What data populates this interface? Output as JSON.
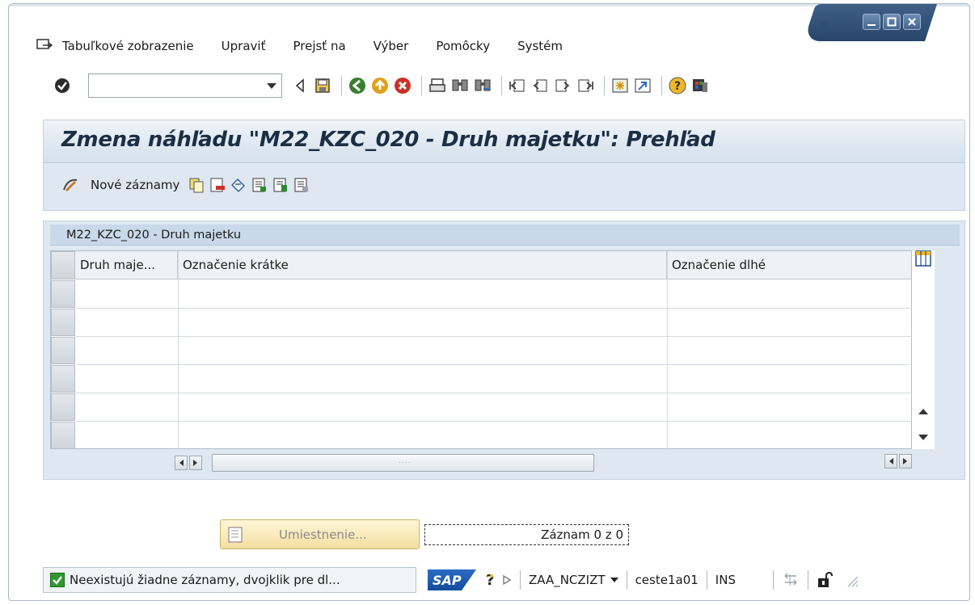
{
  "menubar": {
    "items": [
      {
        "label": "Tabuľkové zobrazenie"
      },
      {
        "label": "Upraviť"
      },
      {
        "label": "Prejsť na"
      },
      {
        "label": "Výber"
      },
      {
        "label": "Pomôcky"
      },
      {
        "label": "Systém"
      }
    ],
    "overflow": "»"
  },
  "toolbar": {
    "command_field_value": "",
    "icons": [
      "enter-check-icon",
      "back-arrow-icon",
      "save-icon",
      "back-icon",
      "exit-icon",
      "cancel-icon",
      "print-icon",
      "find-icon",
      "find-next-icon",
      "first-page-icon",
      "previous-page-icon",
      "next-page-icon",
      "last-page-icon",
      "new-session-icon",
      "shortcut-icon",
      "help-icon",
      "customize-layout-icon"
    ]
  },
  "title": {
    "text": "Zmena náhľadu \"M22_KZC_020 - Druh majetku\": Prehľad"
  },
  "app_toolbar": {
    "new_entries_label": "Nové záznamy",
    "icons": [
      "copy-icon",
      "delete-icon",
      "undo-change-icon",
      "select-all-icon",
      "select-block-icon",
      "deselect-all-icon"
    ]
  },
  "table": {
    "title": "M22_KZC_020 - Druh majetku",
    "columns": [
      "Druh maje...",
      "Označenie krátke",
      "Označenie dlhé"
    ],
    "rows": [
      [
        "",
        "",
        ""
      ],
      [
        "",
        "",
        ""
      ],
      [
        "",
        "",
        ""
      ],
      [
        "",
        "",
        ""
      ],
      [
        "",
        "",
        ""
      ],
      [
        "",
        "",
        ""
      ]
    ],
    "hscroll_grip": "...."
  },
  "buttons": {
    "position_label": "Umiestnenie...",
    "record_label": "Záznam 0 z 0"
  },
  "statusbar": {
    "message": "Neexistujú žiadne záznamy, dvojklik pre dl...",
    "logo": "SAP",
    "system": "ZAA_NCZIZT",
    "server": "ceste1a01",
    "mode": "INS"
  }
}
